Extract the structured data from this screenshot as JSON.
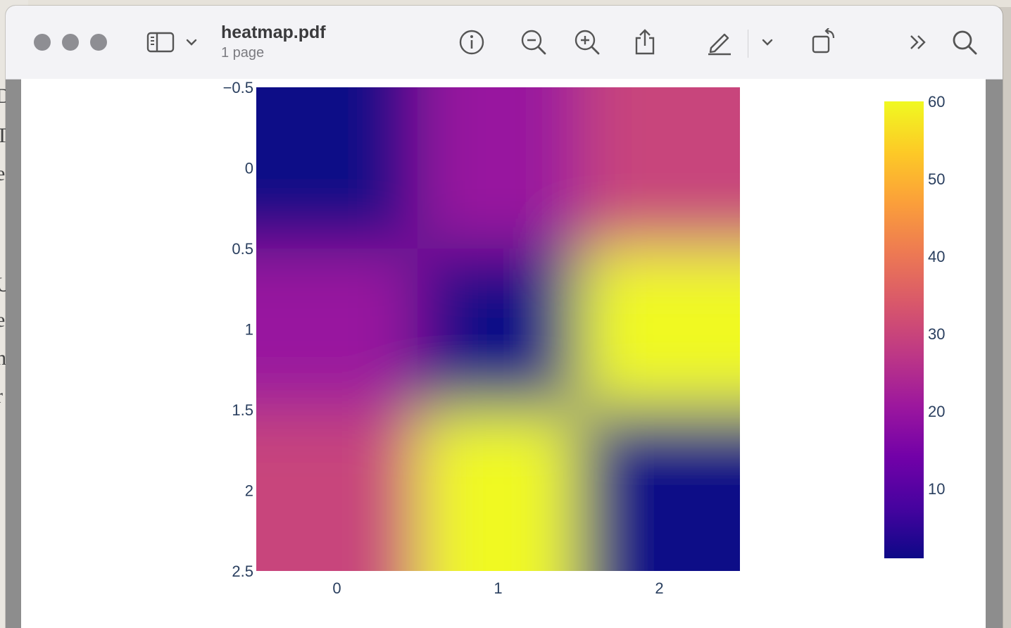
{
  "window": {
    "title": "heatmap.pdf",
    "subtitle": "1 page"
  },
  "toolbar": {
    "icons": [
      "sidebar-icon",
      "chevron-down-icon",
      "info-icon",
      "zoom-out-icon",
      "zoom-in-icon",
      "share-icon",
      "markup-pen-icon",
      "chevron-down-icon",
      "rotate-icon",
      "more-chevrons-icon",
      "search-icon"
    ]
  },
  "chart_data": {
    "type": "heatmap",
    "x": [
      0,
      1,
      2
    ],
    "y": [
      0,
      1,
      2
    ],
    "z": [
      [
        1,
        20,
        30
      ],
      [
        20,
        1,
        60
      ],
      [
        30,
        60,
        1
      ]
    ],
    "colorscale": "plasma",
    "zmin": 1,
    "zmax": 60,
    "interpolation": "smooth",
    "x_ticks": [
      "0",
      "1",
      "2"
    ],
    "y_ticks": [
      "−0.5",
      "0",
      "0.5",
      "1",
      "1.5",
      "2",
      "2.5"
    ],
    "colorbar_ticks": [
      "10",
      "20",
      "30",
      "40",
      "50",
      "60"
    ],
    "y_reversed": true
  }
}
